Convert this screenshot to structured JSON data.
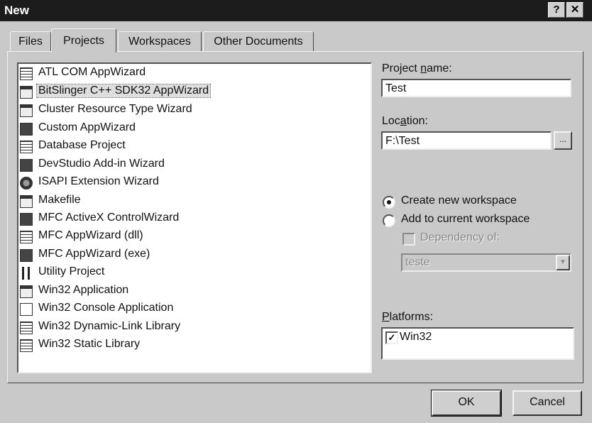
{
  "window": {
    "title": "New",
    "help_button": "?",
    "close_button": "✕"
  },
  "tabs": [
    {
      "label": "Files"
    },
    {
      "label": "Projects"
    },
    {
      "label": "Workspaces"
    },
    {
      "label": "Other Documents"
    }
  ],
  "active_tab": "Projects",
  "projects": [
    {
      "label": "ATL COM AppWizard",
      "icon": "atl-com-icon"
    },
    {
      "label": "BitSlinger C++ SDK32  AppWizard",
      "icon": "bitslinger-wizard-icon",
      "selected": true
    },
    {
      "label": "Cluster Resource Type Wizard",
      "icon": "cluster-wizard-icon"
    },
    {
      "label": "Custom AppWizard",
      "icon": "custom-appwizard-icon"
    },
    {
      "label": "Database Project",
      "icon": "database-project-icon"
    },
    {
      "label": "DevStudio Add-in Wizard",
      "icon": "devstudio-addin-icon"
    },
    {
      "label": "ISAPI Extension Wizard",
      "icon": "isapi-globe-icon"
    },
    {
      "label": "Makefile",
      "icon": "makefile-icon"
    },
    {
      "label": "MFC ActiveX ControlWizard",
      "icon": "mfc-activex-icon"
    },
    {
      "label": "MFC AppWizard (dll)",
      "icon": "mfc-dll-icon"
    },
    {
      "label": "MFC AppWizard (exe)",
      "icon": "mfc-exe-icon"
    },
    {
      "label": "Utility Project",
      "icon": "utility-tools-icon"
    },
    {
      "label": "Win32 Application",
      "icon": "win32-app-icon"
    },
    {
      "label": "Win32 Console Application",
      "icon": "console-app-icon"
    },
    {
      "label": "Win32 Dynamic-Link Library",
      "icon": "dll-icon"
    },
    {
      "label": "Win32 Static Library",
      "icon": "static-library-icon"
    }
  ],
  "project_name": {
    "label_pre": "Project ",
    "label_u": "n",
    "label_post": "ame:",
    "value": "Test"
  },
  "location": {
    "label_pre": "Loc",
    "label_u": "a",
    "label_post": "tion:",
    "value": "F:\\Test",
    "browse_label": "..."
  },
  "workspace_options": {
    "create_new": "Create new workspace",
    "add_to_current": "Add to current workspace",
    "selected": "create_new"
  },
  "dependency": {
    "label": "Dependency of:",
    "checked": false,
    "enabled": false
  },
  "dependency_combo": {
    "value": "teste",
    "enabled": false
  },
  "platforms": {
    "label_u": "P",
    "label_post": "latforms:",
    "items": [
      {
        "label": "Win32",
        "checked": true
      }
    ]
  },
  "buttons": {
    "ok": "OK",
    "cancel": "Cancel"
  }
}
